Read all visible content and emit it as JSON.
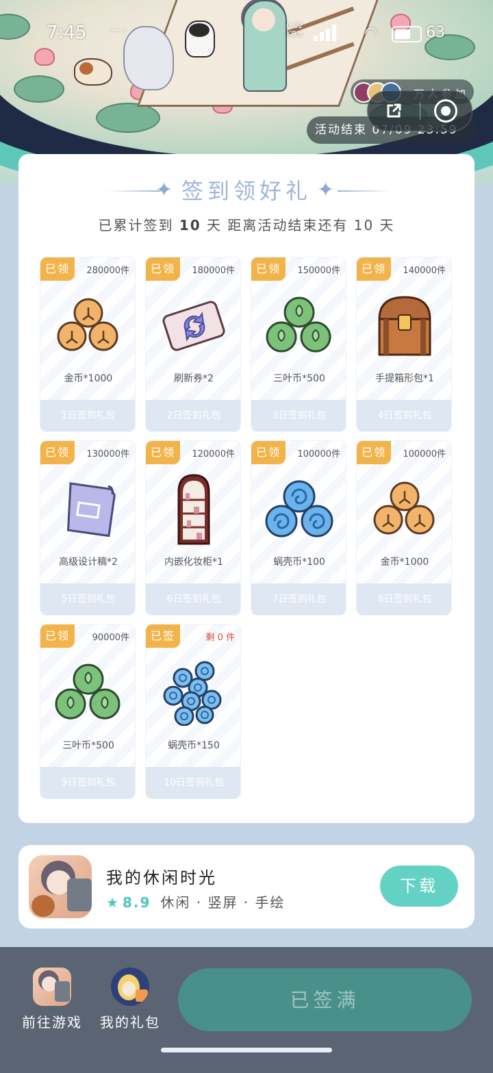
{
  "status_bar": {
    "time": "7:45",
    "dots": "···",
    "speed_value": "0.02",
    "speed_unit": "KB/s",
    "battery": "63"
  },
  "banner": {
    "join_text": "万人参加",
    "activity_end": "活动结束 07/09 23:59"
  },
  "capsule": {
    "share_icon": "share-icon",
    "close_icon": "target-icon"
  },
  "card": {
    "title": "签到领好礼",
    "subtitle_prefix": "已累计签到",
    "subtitle_days": "10",
    "subtitle_mid": "天  距离活动结束还有",
    "subtitle_remaining": "10",
    "subtitle_suffix": "天"
  },
  "rewards": [
    {
      "tag": "已领",
      "count": "280000件",
      "name": "金币*1000",
      "footer": "1日签到礼包",
      "icon": "gold-coin-icon",
      "count_color": "normal"
    },
    {
      "tag": "已领",
      "count": "180000件",
      "name": "刷新券*2",
      "footer": "2日签到礼包",
      "icon": "refresh-ticket-icon",
      "count_color": "normal"
    },
    {
      "tag": "已领",
      "count": "150000件",
      "name": "三叶币*500",
      "footer": "3日签到礼包",
      "icon": "clover-coin-icon",
      "count_color": "normal"
    },
    {
      "tag": "已领",
      "count": "140000件",
      "name": "手提箱形包*1",
      "footer": "4日签到礼包",
      "icon": "treasure-chest-icon",
      "count_color": "normal"
    },
    {
      "tag": "已领",
      "count": "130000件",
      "name": "高级设计稿*2",
      "footer": "5日签到礼包",
      "icon": "blueprint-scroll-icon",
      "count_color": "normal"
    },
    {
      "tag": "已领",
      "count": "120000件",
      "name": "内嵌化妆柜*1",
      "footer": "6日签到礼包",
      "icon": "cabinet-icon",
      "count_color": "normal"
    },
    {
      "tag": "已领",
      "count": "100000件",
      "name": "蜗壳币*100",
      "footer": "7日签到礼包",
      "icon": "snail-coin-icon",
      "count_color": "normal"
    },
    {
      "tag": "已领",
      "count": "100000件",
      "name": "金币*1000",
      "footer": "8日签到礼包",
      "icon": "gold-coin-icon",
      "count_color": "normal"
    },
    {
      "tag": "已领",
      "count": "90000件",
      "name": "三叶币*500",
      "footer": "9日签到礼包",
      "icon": "clover-coin-icon",
      "count_color": "normal"
    },
    {
      "tag": "已签",
      "count": "剩 0 件",
      "name": "蜗壳币*150",
      "footer": "10日签到礼包",
      "icon": "snail-coin-pile-icon",
      "count_color": "red"
    }
  ],
  "app": {
    "name": "我的休闲时光",
    "rating": "8.9",
    "tags": "休闲 · 竖屏 · 手绘",
    "download_label": "下载"
  },
  "bottom_bar": {
    "goto_game_label": "前往游戏",
    "my_gifts_label": "我的礼包",
    "signed_label": "已签满"
  },
  "colors": {
    "tag_orange": "#f2b44a",
    "teal_accent": "#63d1c3",
    "title_blue": "#9db5da",
    "page_bg": "#c3d3e6",
    "bottom_bar": "#5a6472",
    "signed_button": "#49908a"
  }
}
